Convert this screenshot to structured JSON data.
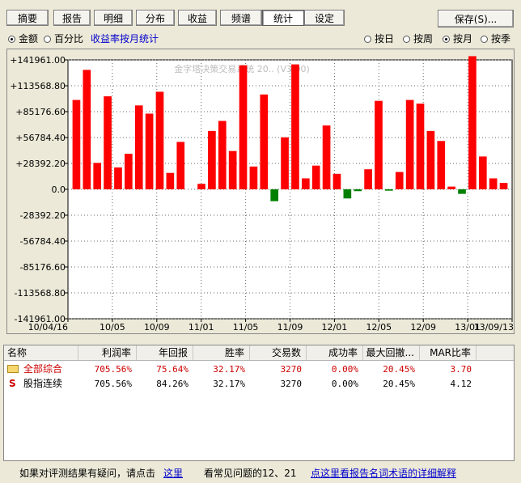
{
  "tabs": [
    {
      "label": "摘要"
    },
    {
      "label": "报告"
    },
    {
      "label": "明细"
    },
    {
      "label": "分布"
    },
    {
      "label": "收益"
    },
    {
      "label": "频谱"
    },
    {
      "label": "统计"
    },
    {
      "label": "设定"
    }
  ],
  "active_tab": "统计",
  "save_label": "保存(S)...",
  "mode_options": [
    {
      "label": "金额",
      "selected": true
    },
    {
      "label": "百分比",
      "selected": false
    }
  ],
  "monthly_stats_link": "收益率按月统计",
  "period_options": [
    {
      "label": "按日",
      "selected": false
    },
    {
      "label": "按周",
      "selected": false
    },
    {
      "label": "按月",
      "selected": true
    },
    {
      "label": "按季",
      "selected": false
    }
  ],
  "chart_data": {
    "type": "bar",
    "watermark": "金字塔决策交易系统 20.. (V3.00)",
    "y_ticks": [
      "+141961.00",
      "+113568.80",
      "+85176.60",
      "+56784.40",
      "+28392.20",
      "0.0",
      "-28392.20",
      "-56784.40",
      "-85176.60",
      "-113568.80",
      "-141961.00"
    ],
    "ylim": [
      -141961,
      141961
    ],
    "x_tick_labels": [
      "10/04/16",
      "10/05",
      "10/09",
      "11/01",
      "11/05",
      "11/09",
      "12/01",
      "12/05",
      "12/09",
      "13/01",
      "13/09/13"
    ],
    "values": [
      98000,
      131000,
      29000,
      102000,
      24000,
      39000,
      92000,
      83000,
      107000,
      18000,
      52000,
      0,
      6000,
      64000,
      75000,
      42000,
      136000,
      25000,
      104000,
      -13000,
      57000,
      137000,
      12000,
      26000,
      70000,
      17000,
      -10000,
      -2000,
      22000,
      97000,
      -1500,
      19000,
      98000,
      94000,
      64000,
      53000,
      3000,
      -5000,
      146000,
      36000,
      12000,
      7000
    ],
    "colors": {
      "positive": "#ff0000",
      "negative": "#008000"
    }
  },
  "table": {
    "headers": [
      "名称",
      "利润率",
      "年回报",
      "胜率",
      "交易数",
      "成功率",
      "最大回撤...",
      "MAR比率"
    ],
    "rows": [
      {
        "name": "全部综合",
        "icon": "folder-icon",
        "values": [
          "705.56%",
          "75.64%",
          "32.17%",
          "3270",
          "0.00%",
          "20.45%",
          "3.70"
        ],
        "highlight": true
      },
      {
        "name": "股指连续",
        "icon": "s-icon",
        "values": [
          "705.56%",
          "84.26%",
          "32.17%",
          "3270",
          "0.00%",
          "20.45%",
          "4.12"
        ],
        "highlight": false
      }
    ]
  },
  "footer": {
    "prompt": "如果对评测结果有疑问，请点击",
    "here_link": "这里",
    "faq_text": "看常见问题的12、21",
    "glossary_link": "点这里看报告名词术语的详细解释"
  }
}
